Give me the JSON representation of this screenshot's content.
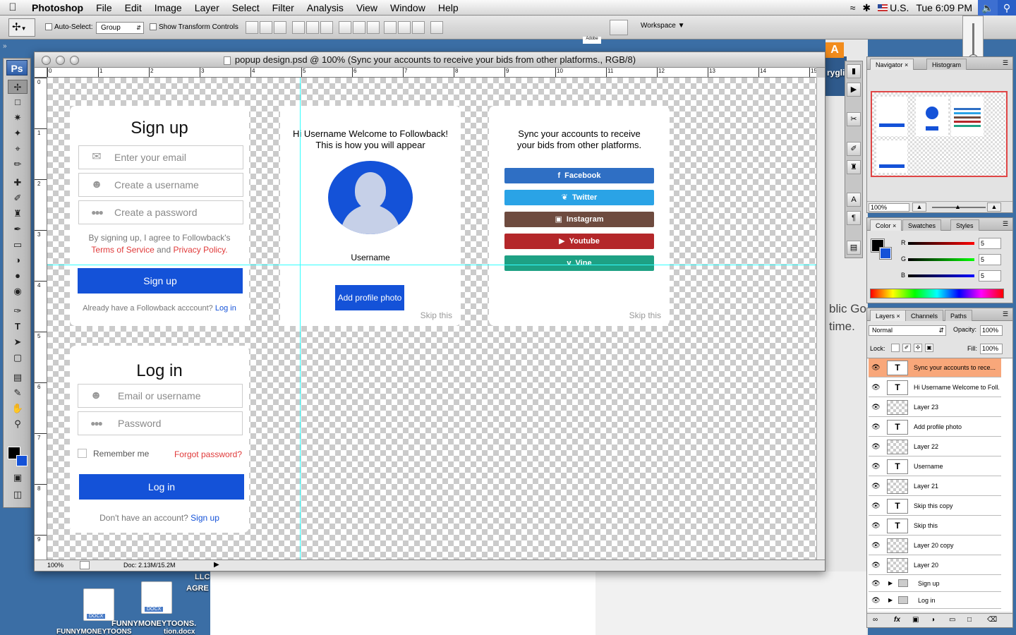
{
  "menubar": {
    "app": "Photoshop",
    "items": [
      "File",
      "Edit",
      "Image",
      "Layer",
      "Select",
      "Filter",
      "Analysis",
      "View",
      "Window",
      "Help"
    ],
    "locale": "U.S.",
    "clock": "Tue 6:09 PM"
  },
  "options": {
    "auto_select_label": "Auto-Select:",
    "auto_select_value": "Group",
    "transform_label": "Show Transform Controls",
    "workspace_label": "Workspace"
  },
  "document": {
    "title": "popup design.psd @ 100% (Sync your accounts to receive  your bids from other platforms., RGB/8)",
    "zoom": "100%",
    "doc_size": "Doc: 2.13M/15.2M",
    "ruler_h": [
      "0",
      "1",
      "2",
      "3",
      "4",
      "5",
      "6",
      "7",
      "8",
      "9",
      "10",
      "11",
      "12",
      "13",
      "14",
      "15"
    ],
    "ruler_v": [
      "0",
      "1",
      "2",
      "3",
      "4",
      "5",
      "6",
      "7",
      "8",
      "9"
    ]
  },
  "signup": {
    "title": "Sign up",
    "email_placeholder": "Enter your email",
    "username_placeholder": "Create a username",
    "password_placeholder": "Create a password",
    "agree_text": "By signing up, I agree to Followback's",
    "terms": "Terms of Service",
    "and": "and",
    "privacy": "Privacy Policy.",
    "button": "Sign up",
    "already": "Already have a Followback acccount?",
    "login_link": "Log in"
  },
  "welcome": {
    "line1": "Hi Username Welcome to Followback!",
    "line2": "This is how you will appear",
    "username": "Username",
    "add_photo": "Add profile photo",
    "skip": "Skip this"
  },
  "sync": {
    "line1": "Sync your accounts to receive",
    "line2": "your bids from other platforms.",
    "buttons": [
      {
        "label": "Facebook",
        "icon": "f",
        "color": "#2f6fc4"
      },
      {
        "label": "Twitter",
        "icon": "t",
        "color": "#2aa3e6"
      },
      {
        "label": "Instagram",
        "icon": "i",
        "color": "#6e4b3f"
      },
      {
        "label": "Youtube",
        "icon": "y",
        "color": "#b4272a"
      },
      {
        "label": "Vine",
        "icon": "v",
        "color": "#1ea184"
      }
    ],
    "skip": "Skip this"
  },
  "login": {
    "title": "Log in",
    "user_placeholder": "Email or username",
    "password_placeholder": "Password",
    "remember": "Remember me",
    "forgot": "Forgot password?",
    "button": "Log in",
    "no_account": "Don't have an account?",
    "signup_link": "Sign up"
  },
  "navigator": {
    "tabs": [
      "Navigator",
      "Histogram"
    ],
    "zoom": "100%"
  },
  "color_panel": {
    "tabs": [
      "Color",
      "Swatches",
      "Styles"
    ],
    "r_label": "R",
    "g_label": "G",
    "b_label": "B",
    "r": "5",
    "g": "5",
    "b": "5"
  },
  "layers_panel": {
    "tabs": [
      "Layers",
      "Channels",
      "Paths"
    ],
    "blend": "Normal",
    "opacity_label": "Opacity:",
    "opacity": "100%",
    "lock_label": "Lock:",
    "fill_label": "Fill:",
    "fill": "100%",
    "layers": [
      {
        "name": "Sync your accounts to rece...",
        "type": "T",
        "active": true
      },
      {
        "name": "Hi Username Welcome to Foll...",
        "type": "T"
      },
      {
        "name": "Layer 23",
        "type": "img"
      },
      {
        "name": "Add profile photo",
        "type": "T"
      },
      {
        "name": "Layer 22",
        "type": "img"
      },
      {
        "name": "Username",
        "type": "T"
      },
      {
        "name": "Layer 21",
        "type": "img"
      },
      {
        "name": "Skip this copy",
        "type": "T"
      },
      {
        "name": "Skip this",
        "type": "T"
      },
      {
        "name": "Layer 20 copy",
        "type": "img"
      },
      {
        "name": "Layer 20",
        "type": "img"
      }
    ],
    "groups": [
      "Sign up",
      "Log in"
    ]
  },
  "desktop": {
    "right_text1": "blic Go",
    "right_text2": "time.",
    "label_llc": "LLC",
    "label_agre": "AGRE",
    "icon1": "FUNNYMONEYTOONS.",
    "icon2": "FUNNYMONEYTOONS",
    "icon3": "tion.docx",
    "top_text": "rygli",
    "adobe": "Adobe",
    "docx": "DOCX"
  }
}
